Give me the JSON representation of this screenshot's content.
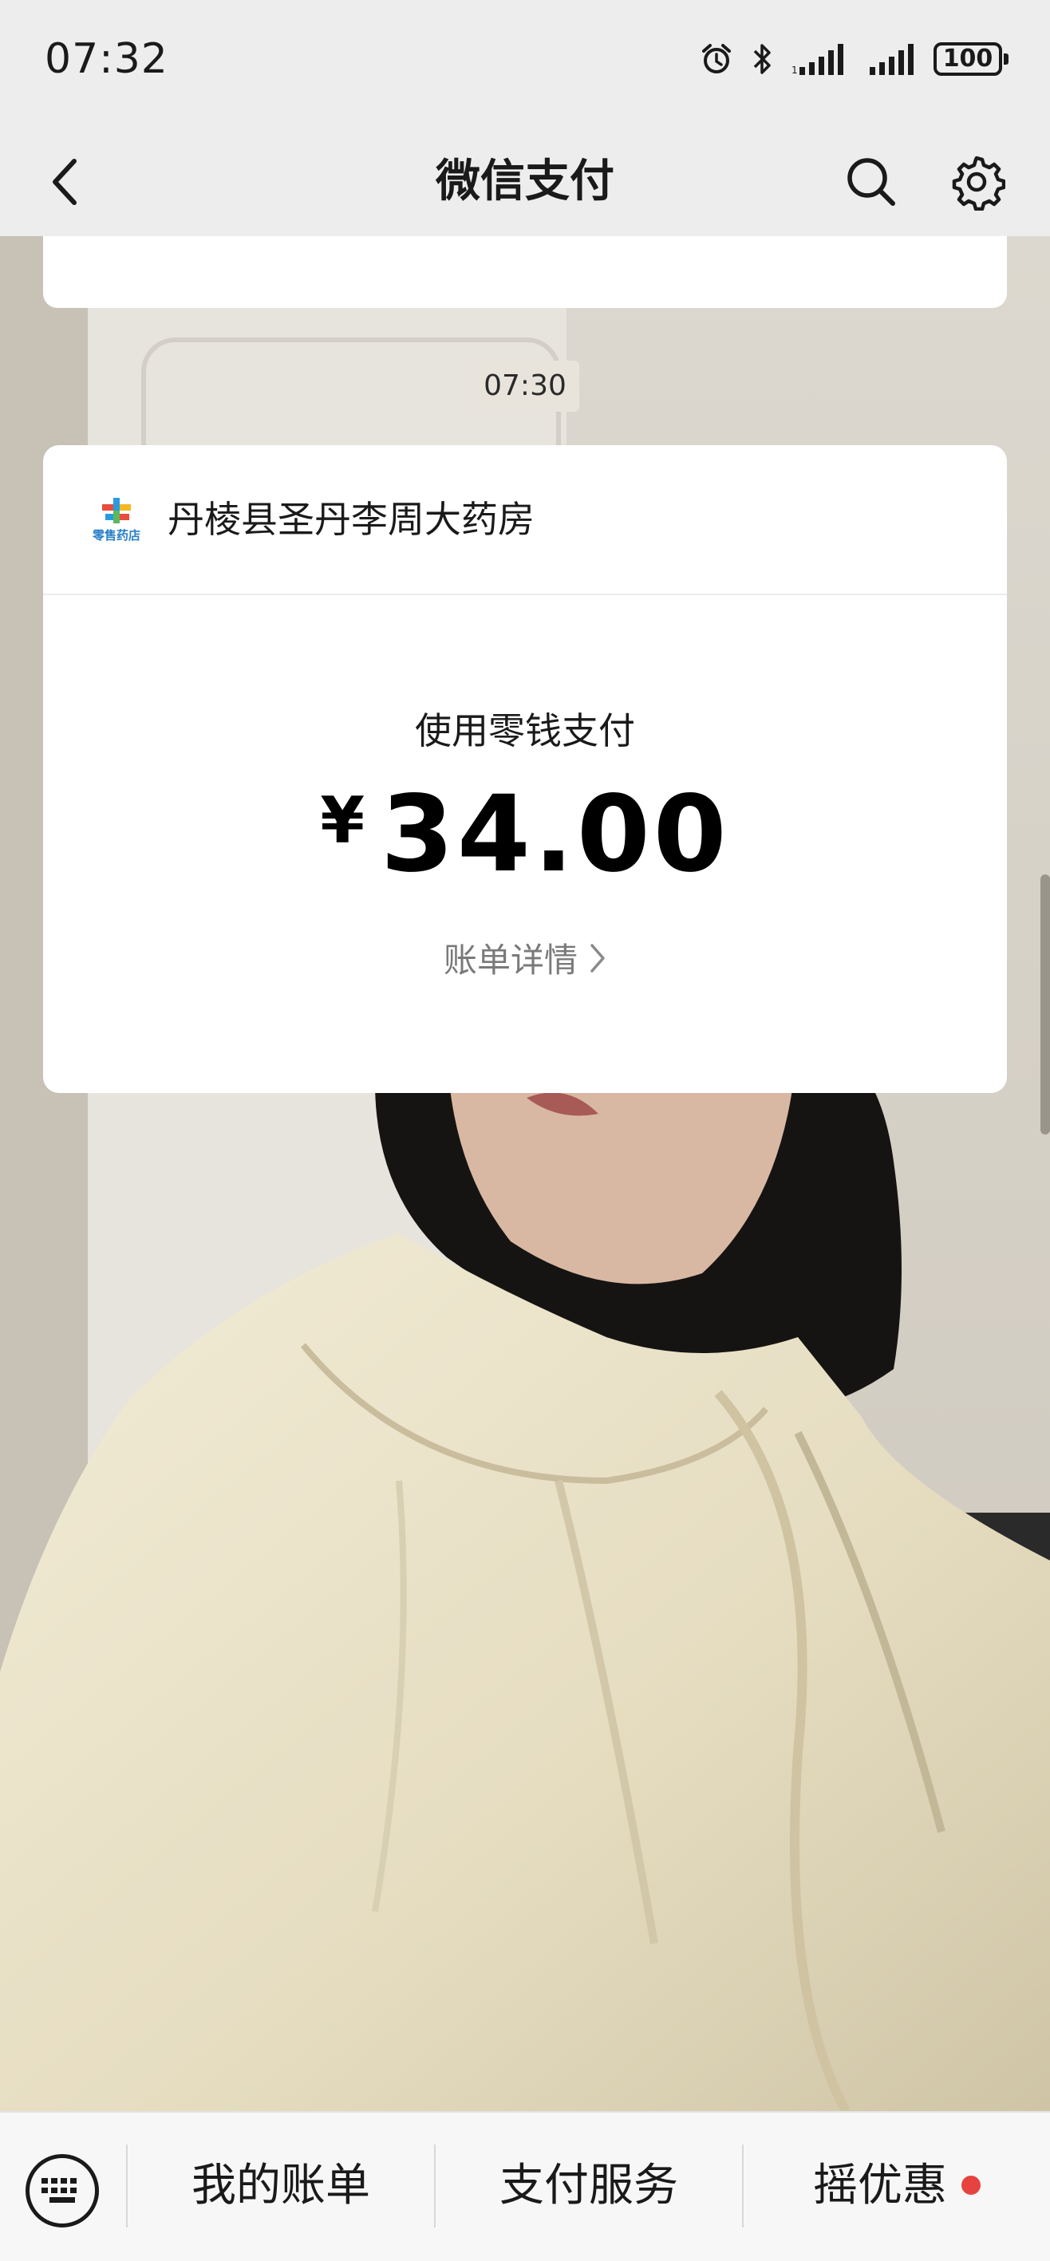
{
  "status_bar": {
    "time": "07:32",
    "battery": "100",
    "icons": [
      "alarm-icon",
      "bluetooth-icon",
      "signal-icon",
      "signal-icon",
      "battery-icon"
    ]
  },
  "nav": {
    "title": "微信支付",
    "back_icon": "chevron-left-icon",
    "search_icon": "search-icon",
    "settings_icon": "gear-icon"
  },
  "chat": {
    "timestamp": "07:30",
    "payment_card": {
      "merchant_name": "丹棱县圣丹李周大药房",
      "merchant_logo_text": "零售药店",
      "method": "使用零钱支付",
      "currency_symbol": "¥",
      "amount": "34.00",
      "detail_link": "账单详情"
    }
  },
  "bottom_menu": {
    "keyboard_icon": "keyboard-icon",
    "items": [
      {
        "label": "我的账单"
      },
      {
        "label": "支付服务"
      },
      {
        "label": "摇优惠",
        "has_badge": true
      }
    ],
    "badge_color": "#e64340"
  }
}
